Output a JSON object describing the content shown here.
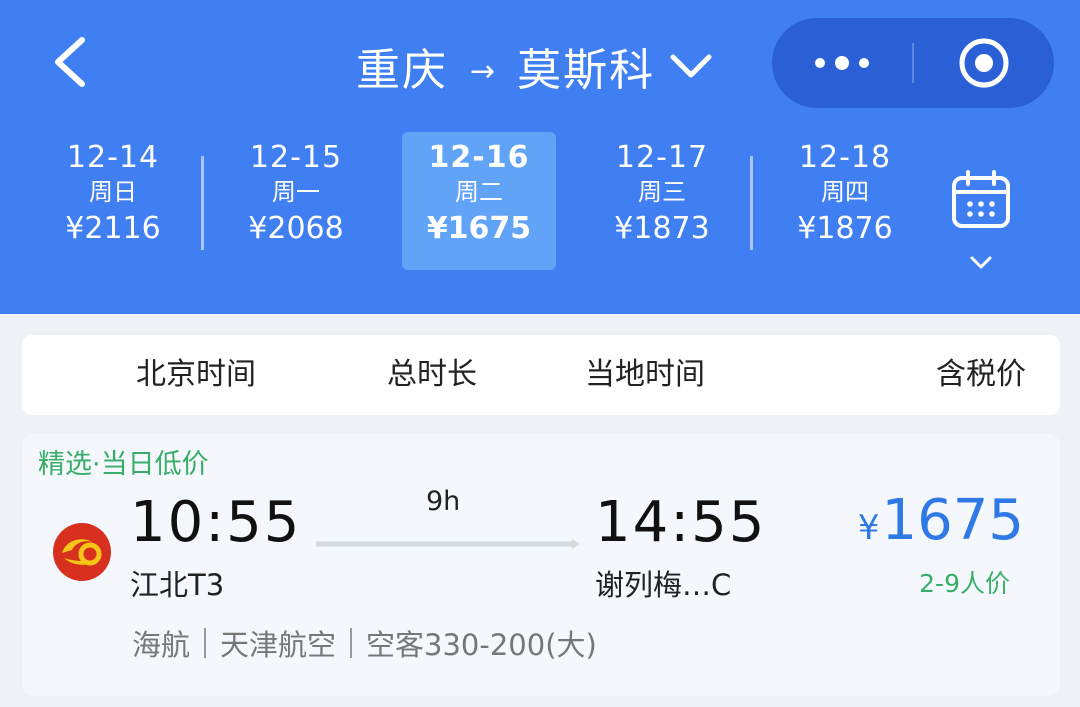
{
  "header": {
    "origin": "重庆",
    "arrow": "→",
    "destination": "莫斯科"
  },
  "dates": [
    {
      "date": "12-14",
      "weekday": "周日",
      "price": "¥2116"
    },
    {
      "date": "12-15",
      "weekday": "周一",
      "price": "¥2068"
    },
    {
      "date": "12-16",
      "weekday": "周二",
      "price": "¥1675",
      "selected": true
    },
    {
      "date": "12-17",
      "weekday": "周三",
      "price": "¥1873"
    },
    {
      "date": "12-18",
      "weekday": "周四",
      "price": "¥1876"
    }
  ],
  "tabs": {
    "beijing_time": "北京时间",
    "duration": "总时长",
    "local_time": "当地时间",
    "price_incl_tax": "含税价"
  },
  "flight": {
    "tag": "精选·当日低价",
    "airline_logo": "hainan-airlines-logo",
    "dep_time": "10:55",
    "dep_airport": "江北T3",
    "duration": "9h",
    "arr_time": "14:55",
    "arr_airport": "谢列梅…C",
    "currency": "¥",
    "price": "1675",
    "price_note": "2-9人价",
    "airline": "海航",
    "operator": "天津航空",
    "aircraft": "空客330-200(大)"
  },
  "colors": {
    "header_bg": "#3f7ff1",
    "selected_date_bg": "#61a3f7",
    "price_blue": "#2f79e6",
    "tag_green": "#3aae68",
    "logo_red": "#d7301f",
    "logo_yellow": "#f5c518"
  },
  "icons": [
    "back-arrow-icon",
    "chevron-down-icon",
    "more-dots-icon",
    "target-icon",
    "calendar-icon",
    "hainan-airlines-logo"
  ]
}
